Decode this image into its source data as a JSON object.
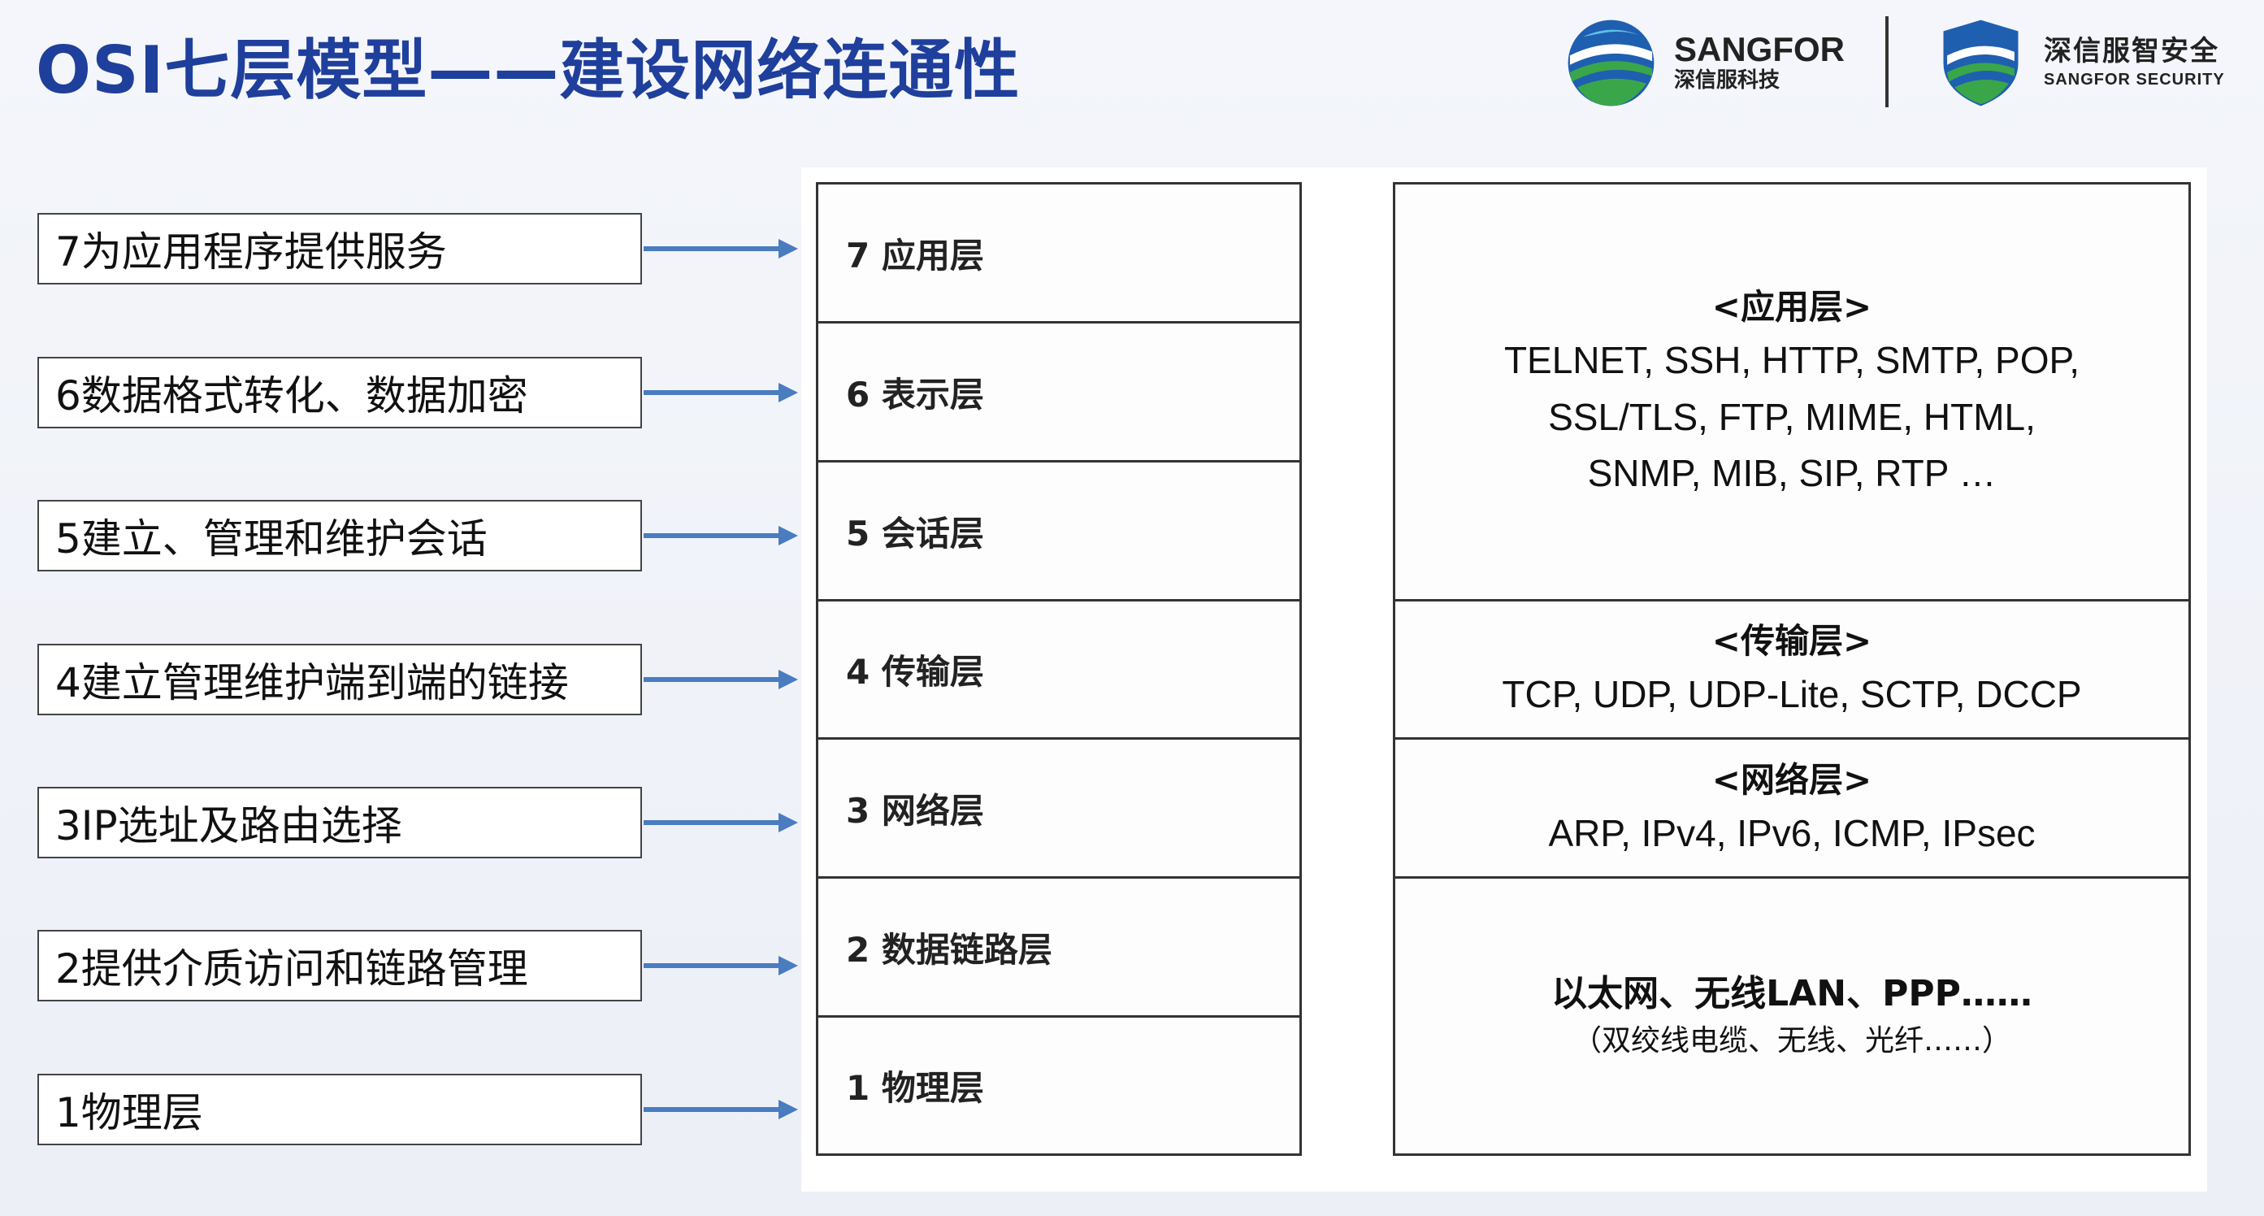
{
  "title": "OSI七层模型——建设网络连通性",
  "logos": {
    "sangfor": {
      "en": "SANGFOR",
      "cn": "深信服科技"
    },
    "security": {
      "cn": "深信服智安全",
      "en": "SANGFOR SECURITY"
    }
  },
  "colors": {
    "title": "#1f3f9c",
    "arrow": "#4a7cc0",
    "globe_blue": "#1f5fb0",
    "globe_green": "#3aa64a"
  },
  "descriptions": [
    "7为应用程序提供服务",
    "6数据格式转化、数据加密",
    "5建立、管理和维护会话",
    "4建立管理维护端到端的链接",
    "3IP选址及路由选择",
    "2提供介质访问和链路管理",
    "1物理层"
  ],
  "layers": [
    "7 应用层",
    "6 表示层",
    "5 会话层",
    "4 传输层",
    "3 网络层",
    "2 数据链路层",
    "1 物理层"
  ],
  "protocols": {
    "application": {
      "heading": "<应用层>",
      "lines": [
        "TELNET, SSH, HTTP, SMTP, POP,",
        "SSL/TLS, FTP, MIME, HTML,",
        "SNMP, MIB, SIP, RTP …"
      ]
    },
    "transport": {
      "heading": "<传输层>",
      "lines": [
        "TCP, UDP, UDP-Lite, SCTP, DCCP"
      ]
    },
    "network": {
      "heading": "<网络层>",
      "lines": [
        "ARP, IPv4, IPv6, ICMP, IPsec"
      ]
    },
    "link": {
      "main": "以太网、无线LAN、PPP……",
      "note": "（双绞线电缆、无线、光纤……）"
    }
  }
}
